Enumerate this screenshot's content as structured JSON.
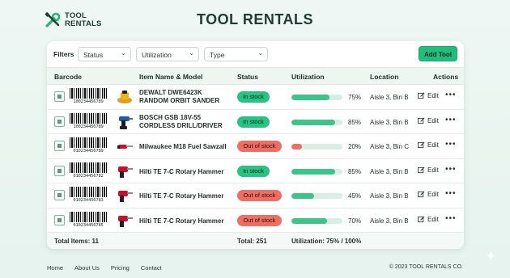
{
  "brand": {
    "line1": "TOOL",
    "line2": "RENTALS",
    "icon": "wrench-screwdriver-icon"
  },
  "title": "TOOL RENTALS",
  "filters": {
    "label": "Filters",
    "status": "Status",
    "utilization": "Utilization",
    "type": "Type",
    "add_button": "Add Tool"
  },
  "columns": {
    "barcode": "Barcode",
    "item": "Item Name & Model",
    "status": "Status",
    "utilization": "Utilization",
    "location": "Location",
    "actions": "Actions"
  },
  "rows": [
    {
      "barcode": "100234456789",
      "name_line1": "DEWALT DWE6423K",
      "name_line2": "RANDOM ORBIT SANDER",
      "status": "In stock",
      "in_stock": true,
      "utilization": 75,
      "utilization_label": "75%",
      "location": "Aisle 3, Bin B",
      "edit": "Edit",
      "tool_icon": "sander-icon"
    },
    {
      "barcode": "100234456789",
      "name_line1": "BOSCH GSB 18V-55",
      "name_line2": "CORDLESS DRILL/DRIVER",
      "status": "In stock",
      "in_stock": true,
      "utilization": 85,
      "utilization_label": "85%",
      "location": "Aisle 3, Bin B",
      "edit": "Edit",
      "tool_icon": "drill-icon"
    },
    {
      "barcode": "010234456789",
      "name_line1": "Milwaukee M18 Fuel Sawzall",
      "name_line2": "",
      "status": "Out of stock",
      "in_stock": false,
      "utilization": 20,
      "utilization_label": "20%",
      "location": "Aisle 3, Bin C",
      "edit": "Edit",
      "tool_icon": "saw-icon"
    },
    {
      "barcode": "010234456782",
      "name_line1": "Hilti TE 7-C Rotary Hammer",
      "name_line2": "",
      "status": "In stock",
      "in_stock": true,
      "utilization": 85,
      "utilization_label": "85%",
      "location": "Aisle 3, Bin B",
      "edit": "Edit",
      "tool_icon": "rotary-hammer-icon"
    },
    {
      "barcode": "010234456783",
      "name_line1": "Hilti TE 7-C Rotary Hammer",
      "name_line2": "",
      "status": "Out of stock",
      "in_stock": false,
      "utilization": 45,
      "utilization_label": "45%",
      "location": "Aisle 3, Bin B",
      "edit": "Edit",
      "tool_icon": "rotary-hammer-icon"
    },
    {
      "barcode": "010234456785",
      "name_line1": "Hilti TE 7-C Rotary Hammer",
      "name_line2": "",
      "status": "Out of stock",
      "in_stock": false,
      "utilization": 70,
      "utilization_label": "70%",
      "location": "Aisle 3, Bin B",
      "edit": "Edit",
      "tool_icon": "rotary-hammer-icon"
    }
  ],
  "totals": {
    "items": "Total Items: 11",
    "total": "Total: 251",
    "utilization": "Utilization: 75% / 100%"
  },
  "footer": {
    "links": [
      "Home",
      "About Us",
      "Pricing",
      "Contact"
    ],
    "copyright": "© 2023 TOOL RENTALS CO."
  },
  "colors": {
    "accent": "#1fbf7a",
    "in_stock": "#28c283",
    "out_of_stock": "#ee6e63",
    "util_fill_normal": "#3cc48b",
    "util_fill_low": "#ee6e63"
  }
}
